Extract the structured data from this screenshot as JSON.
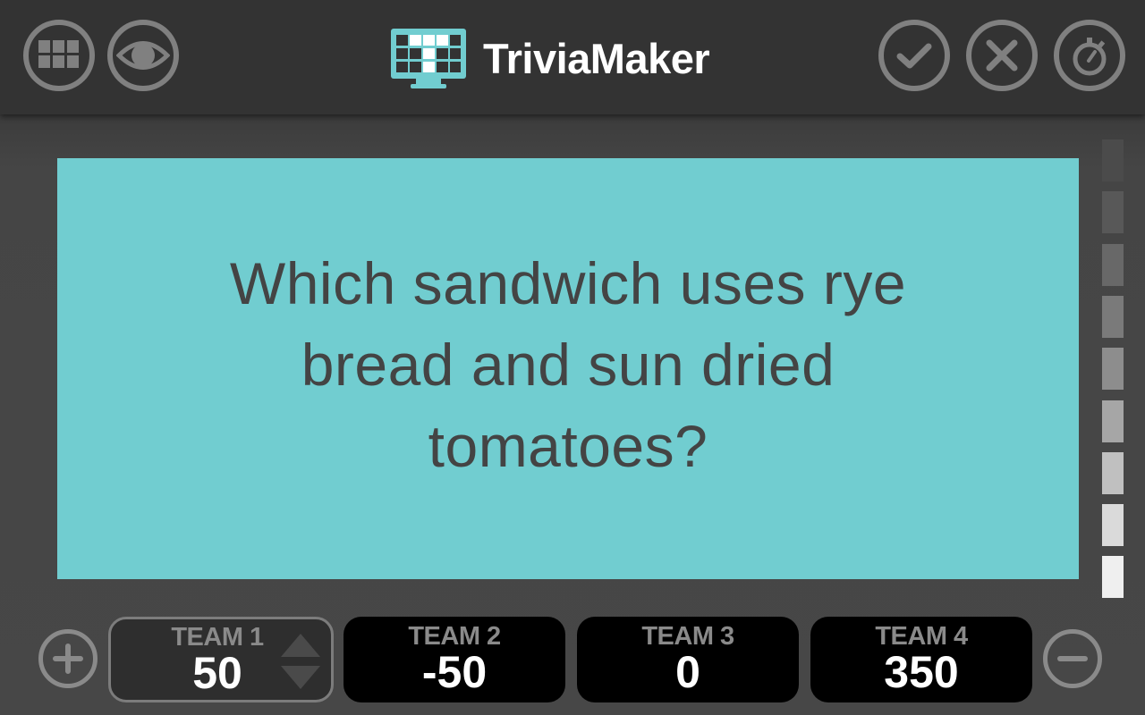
{
  "header": {
    "app_title": "TriviaMaker",
    "left_buttons": [
      {
        "name": "board-grid",
        "icon": "grid-icon"
      },
      {
        "name": "reveal-answer",
        "icon": "eye-icon"
      }
    ],
    "right_buttons": [
      {
        "name": "correct",
        "icon": "check-icon"
      },
      {
        "name": "incorrect",
        "icon": "close-icon"
      },
      {
        "name": "timer",
        "icon": "stopwatch-icon"
      }
    ],
    "logo_icon": "monitor-grid-logo-icon"
  },
  "question": {
    "text": "Which sandwich uses rye bread and sun dried tomatoes?",
    "card_color": "#71cdd0"
  },
  "timer": {
    "segments_total": 9,
    "segments_remaining": 9,
    "segment_colors": [
      "#4b4b4b",
      "#585858",
      "#686868",
      "#7a7a7a",
      "#8d8d8d",
      "#a6a6a6",
      "#c0c0c0",
      "#dadada",
      "#efefef"
    ]
  },
  "score_controls": {
    "add_team_icon": "plus-circle-icon",
    "remove_team_icon": "minus-circle-icon"
  },
  "teams": [
    {
      "name": "TEAM 1",
      "score": "50",
      "active": true
    },
    {
      "name": "TEAM 2",
      "score": "-50",
      "active": false
    },
    {
      "name": "TEAM 3",
      "score": "0",
      "active": false
    },
    {
      "name": "TEAM 4",
      "score": "350",
      "active": false
    }
  ],
  "colors": {
    "header_bg": "#333333",
    "body_bg": "#444444",
    "icon_gray": "#808080",
    "question_text": "#444444",
    "team_card_bg": "#000000",
    "active_team_bg": "#2e2e2e"
  }
}
